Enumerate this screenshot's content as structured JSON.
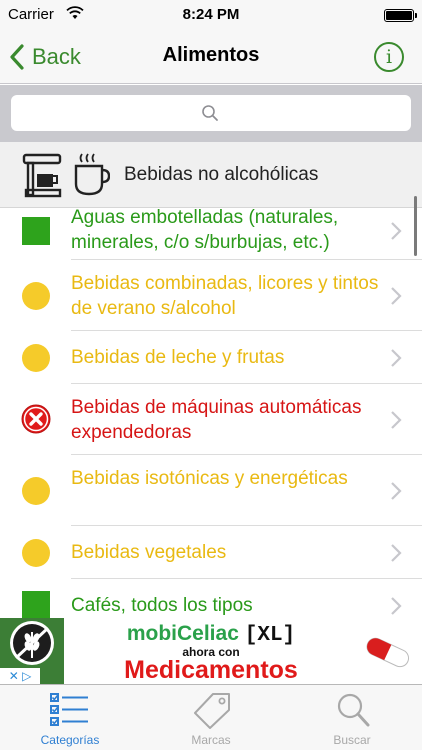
{
  "status_bar": {
    "carrier": "Carrier",
    "time": "8:24 PM"
  },
  "nav": {
    "back_label": "Back",
    "title": "Alimentos"
  },
  "search": {
    "placeholder": ""
  },
  "section": {
    "label": "Bebidas no alcohólicas"
  },
  "list": {
    "items": [
      {
        "text": "Aguas embotelladas (naturales, minerales, c/o s/burbujas, etc.)",
        "status": "green-square"
      },
      {
        "text": "Bebidas combinadas, licores y tintos de verano s/alcohol",
        "status": "yellow-circle"
      },
      {
        "text": "Bebidas de leche y frutas",
        "status": "yellow-circle"
      },
      {
        "text": "Bebidas de máquinas automáticas expendedoras",
        "status": "red-cross"
      },
      {
        "text": "Bebidas isotónicas y energéticas",
        "status": "yellow-circle"
      },
      {
        "text": "Bebidas vegetales",
        "status": "yellow-circle"
      },
      {
        "text": "Cafés, todos los tipos",
        "status": "green-square"
      }
    ]
  },
  "ad": {
    "brand_part1": "mobiCeliac",
    "brand_part2": "[XL]",
    "subline": "ahora con",
    "headline": "Medicamentos"
  },
  "tabs": [
    {
      "label": "Categorías",
      "icon": "categories-list-icon",
      "active": true
    },
    {
      "label": "Marcas",
      "icon": "tag-icon",
      "active": false
    },
    {
      "label": "Buscar",
      "icon": "search-magnifier-icon",
      "active": false
    }
  ],
  "colors": {
    "accent_green": "#3a8a2e",
    "status_green": "#2ea31c",
    "status_yellow": "#f5cb2a",
    "status_red": "#e01b1b",
    "tab_active": "#2f7fd2",
    "tab_inactive": "#a8a8a8"
  }
}
